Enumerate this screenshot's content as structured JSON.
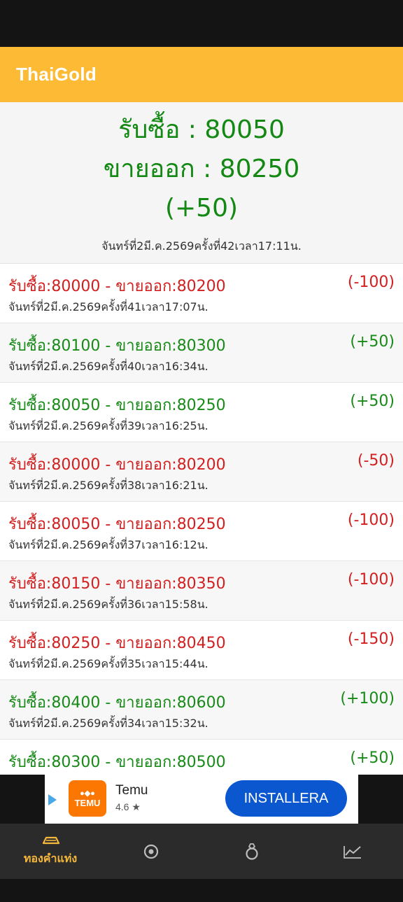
{
  "app": {
    "title": "ThaiGold"
  },
  "summary": {
    "buy": "รับซื้อ : 80050",
    "sell": "ขายออก : 80250",
    "change": "(+50)",
    "date": "จันทร์ที่2มี.ค.2569ครั้งที่42เวลา17:11น."
  },
  "history": [
    {
      "price": "รับซื้อ:80000 - ขายออก:80200",
      "change": "(-100)",
      "time": "จันทร์ที่2มี.ค.2569ครั้งที่41เวลา17:07น.",
      "trend": "down"
    },
    {
      "price": "รับซื้อ:80100 - ขายออก:80300",
      "change": "(+50)",
      "time": "จันทร์ที่2มี.ค.2569ครั้งที่40เวลา16:34น.",
      "trend": "up"
    },
    {
      "price": "รับซื้อ:80050 - ขายออก:80250",
      "change": "(+50)",
      "time": "จันทร์ที่2มี.ค.2569ครั้งที่39เวลา16:25น.",
      "trend": "up"
    },
    {
      "price": "รับซื้อ:80000 - ขายออก:80200",
      "change": "(-50)",
      "time": "จันทร์ที่2มี.ค.2569ครั้งที่38เวลา16:21น.",
      "trend": "down"
    },
    {
      "price": "รับซื้อ:80050 - ขายออก:80250",
      "change": "(-100)",
      "time": "จันทร์ที่2มี.ค.2569ครั้งที่37เวลา16:12น.",
      "trend": "down"
    },
    {
      "price": "รับซื้อ:80150 - ขายออก:80350",
      "change": "(-100)",
      "time": "จันทร์ที่2มี.ค.2569ครั้งที่36เวลา15:58น.",
      "trend": "down"
    },
    {
      "price": "รับซื้อ:80250 - ขายออก:80450",
      "change": "(-150)",
      "time": "จันทร์ที่2มี.ค.2569ครั้งที่35เวลา15:44น.",
      "trend": "down"
    },
    {
      "price": "รับซื้อ:80400 - ขายออก:80600",
      "change": "(+100)",
      "time": "จันทร์ที่2มี.ค.2569ครั้งที่34เวลา15:32น.",
      "trend": "up"
    },
    {
      "price": "รับซื้อ:80300 - ขายออก:80500",
      "change": "(+50)",
      "time": "",
      "trend": "up"
    }
  ],
  "ad": {
    "brand": "Temu",
    "logo_text": "TEMU",
    "rating": "4.6 ★",
    "install_label": "INSTALLERA"
  },
  "nav": {
    "gold_bar_label": "ทองคำแท่ง",
    "icons": [
      "gold-bar-icon",
      "target-icon",
      "ring-icon",
      "chart-icon"
    ]
  },
  "colors": {
    "accent": "#fdbb35",
    "up": "#178a17",
    "down": "#d21f1f",
    "nav_active": "#f4b73b",
    "ad_button": "#0b57d0",
    "temu": "#fb7701"
  }
}
